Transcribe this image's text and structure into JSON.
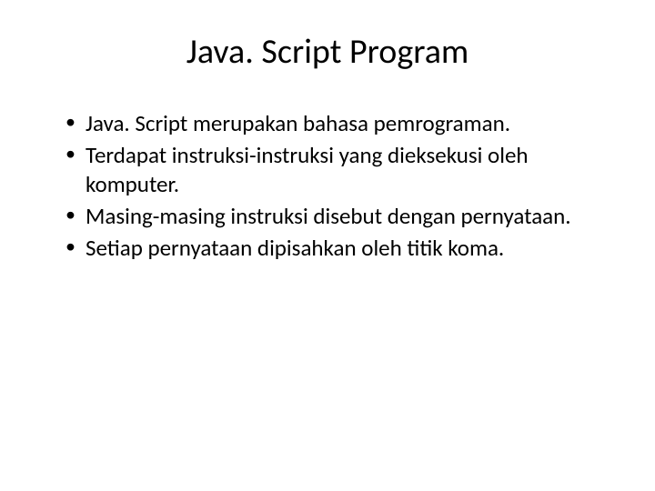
{
  "slide": {
    "title": "Java. Script Program",
    "bullets": [
      "Java. Script merupakan bahasa pemrograman.",
      "Terdapat instruksi-instruksi yang dieksekusi oleh komputer.",
      "Masing-masing instruksi disebut dengan pernyataan.",
      "Setiap pernyataan dipisahkan oleh titik koma."
    ]
  }
}
